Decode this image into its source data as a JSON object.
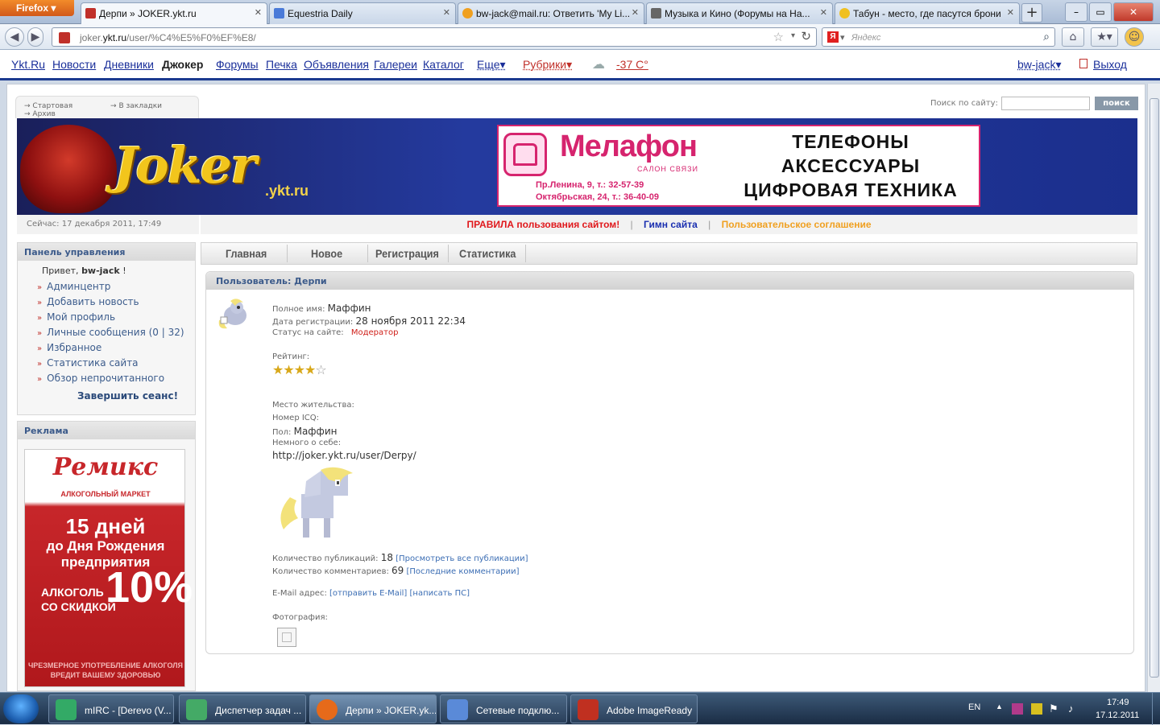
{
  "browser": {
    "menu_label": "Firefox",
    "tabs": [
      {
        "title": "Дерпи » JOKER.ykt.ru",
        "icon_color": "#c0302a",
        "active": true
      },
      {
        "title": "Equestria Daily",
        "icon_color": "#4a7ad8"
      },
      {
        "title": "bw-jack@mail.ru: Ответить 'My Li...",
        "icon_color": "#f0a020"
      },
      {
        "title": "Музыка и Кино (Форумы на На...",
        "icon_color": "#666"
      },
      {
        "title": "Табун - место, где пасутся брони",
        "icon_color": "#f0c020"
      }
    ],
    "newtab": "+",
    "url_prefix": "joker.",
    "url_host": "ykt.ru",
    "url_path": "/user/%C4%E5%F0%EF%E8/",
    "search_placeholder": "Яндекс"
  },
  "sitebar": {
    "links": [
      "Ykt.Ru",
      "Новости",
      "Дневники",
      "Джокер",
      "Форумы",
      "Печка",
      "Объявления",
      "Галереи",
      "Каталог"
    ],
    "more": "Еще▾",
    "rubrics": "Рубрики▾",
    "weather": "-37 С°",
    "user": "bw-jack▾",
    "logout": "Выход"
  },
  "crumbs": [
    "Стартовая",
    "В закладки",
    "Архив"
  ],
  "site_search": {
    "label": "Поиск по сайту:",
    "button": "поиск"
  },
  "banner": {
    "logo": "Joker",
    "logo_sub": ".ykt.ru",
    "ad_name": "Мелафон",
    "ad_sub": "САЛОН СВЯЗИ",
    "ad_addr1": "Пр.Ленина, 9, т.: 32-57-39",
    "ad_addr2": "Октябрьская, 24, т.: 36-40-09",
    "ad_line1": "ТЕЛЕФОНЫ",
    "ad_line2": "АКСЕССУАРЫ",
    "ad_line3": "ЦИФРОВАЯ ТЕХНИКА"
  },
  "now": "Сейчас: 17 декабря 2011, 17:49",
  "rules": {
    "rules": "ПРАВИЛА пользования сайтом!",
    "anthem": "Гимн сайта",
    "agreement": "Пользовательское соглашение",
    "sep": "|",
    "colors": {
      "rules": "#e0181c",
      "anthem": "#1a2fb0",
      "agreement": "#f0a020"
    }
  },
  "control_panel": {
    "title": "Панель управления",
    "hello": "Привет,",
    "user": "bw-jack",
    "excl": "!",
    "items": [
      "Админцентр",
      "Добавить новость",
      "Мой профиль",
      "Личные сообщения (0 | 32)",
      "Избранное",
      "Статистика сайта",
      "Обзор непрочитанного"
    ],
    "logout": "Завершить сеанс!"
  },
  "ads_panel": {
    "title": "Реклама",
    "brand": "Ремикс",
    "brand_sub": "АЛКОГОЛЬНЫЙ МАРКЕТ",
    "days": "15 дней",
    "days2": "до Дня Рождения",
    "days3": "предприятия",
    "pct": "10%",
    "alc": "АЛКОГОЛЬ",
    "alc2": "СО СКИДКОЙ",
    "warn1": "ЧРЕЗМЕРНОЕ УПОТРЕБЛЕНИЕ АЛКОГОЛЯ",
    "warn2": "ВРЕДИТ ВАШЕМУ ЗДОРОВЬЮ"
  },
  "mainnav": [
    "Главная",
    "Новое",
    "Регистрация",
    "Статистика"
  ],
  "profile": {
    "header": "Пользователь: Дерпи",
    "fullname_label": "Полное имя:",
    "fullname": "Маффин",
    "reg_label": "Дата регистрации:",
    "reg": "28 ноября 2011 22:34",
    "status_label": "Статус на сайте:",
    "status": "Модератор",
    "rating_label": "Рейтинг:",
    "rating": 4,
    "rating_max": 5,
    "city_label": "Место жительства:",
    "icq_label": "Номер ICQ:",
    "gender_label": "Пол:",
    "gender": "Маффин",
    "about_label": "Немного о себе:",
    "about_url": "http://joker.ykt.ru/user/Derpy/",
    "posts_label": "Количество публикаций:",
    "posts": "18",
    "posts_link": "[Просмотреть все публикации]",
    "comments_label": "Количество комментариев:",
    "comments": "69",
    "comments_link": "[Последние комментарии]",
    "email_label": "E-Mail адрес:",
    "email_link": "[отправить E-Mail]",
    "pm_link": "[написать ПС]",
    "photo_label": "Фотография:"
  },
  "taskbar": {
    "items": [
      {
        "label": "mIRC - [Derevo (V...",
        "color": "#3a6"
      },
      {
        "label": "Диспетчер задач ...",
        "color": "#4a6"
      },
      {
        "label": "Дерпи » JOKER.yk...",
        "color": "#e66a1a",
        "active": true
      },
      {
        "label": "Сетевые подклю...",
        "color": "#5a8ad8"
      },
      {
        "label": "Adobe ImageReady",
        "color": "#c03020"
      }
    ],
    "lang": "EN",
    "time": "17:49",
    "date": "17.12.2011"
  }
}
